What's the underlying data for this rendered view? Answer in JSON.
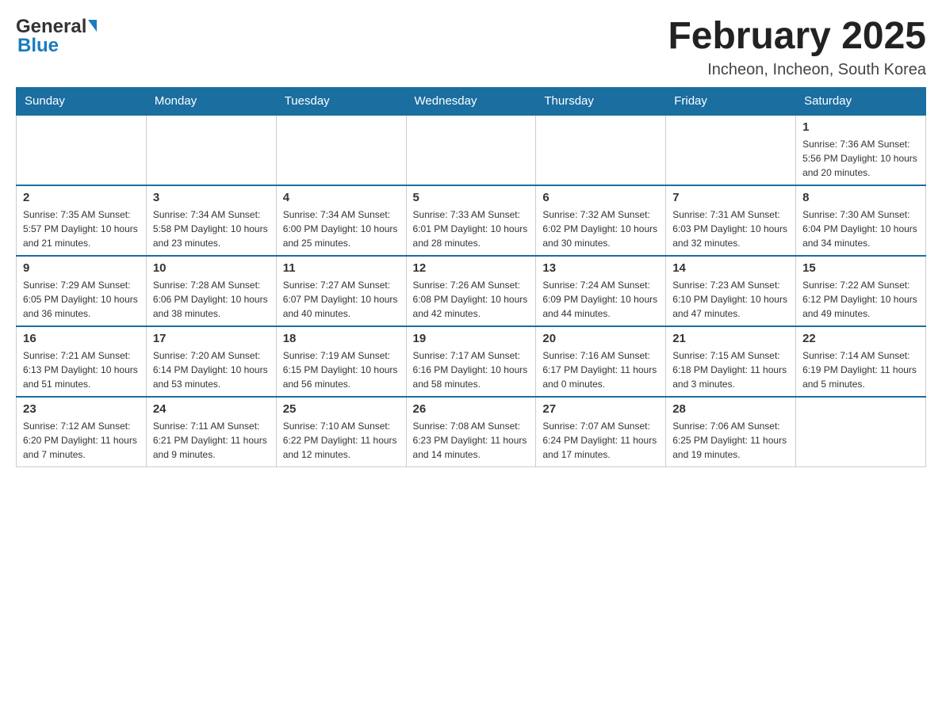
{
  "header": {
    "logo_general": "General",
    "logo_blue": "Blue",
    "title": "February 2025",
    "location": "Incheon, Incheon, South Korea"
  },
  "weekdays": [
    "Sunday",
    "Monday",
    "Tuesday",
    "Wednesday",
    "Thursday",
    "Friday",
    "Saturday"
  ],
  "weeks": [
    {
      "days": [
        {
          "number": "",
          "info": ""
        },
        {
          "number": "",
          "info": ""
        },
        {
          "number": "",
          "info": ""
        },
        {
          "number": "",
          "info": ""
        },
        {
          "number": "",
          "info": ""
        },
        {
          "number": "",
          "info": ""
        },
        {
          "number": "1",
          "info": "Sunrise: 7:36 AM\nSunset: 5:56 PM\nDaylight: 10 hours and 20 minutes."
        }
      ]
    },
    {
      "days": [
        {
          "number": "2",
          "info": "Sunrise: 7:35 AM\nSunset: 5:57 PM\nDaylight: 10 hours and 21 minutes."
        },
        {
          "number": "3",
          "info": "Sunrise: 7:34 AM\nSunset: 5:58 PM\nDaylight: 10 hours and 23 minutes."
        },
        {
          "number": "4",
          "info": "Sunrise: 7:34 AM\nSunset: 6:00 PM\nDaylight: 10 hours and 25 minutes."
        },
        {
          "number": "5",
          "info": "Sunrise: 7:33 AM\nSunset: 6:01 PM\nDaylight: 10 hours and 28 minutes."
        },
        {
          "number": "6",
          "info": "Sunrise: 7:32 AM\nSunset: 6:02 PM\nDaylight: 10 hours and 30 minutes."
        },
        {
          "number": "7",
          "info": "Sunrise: 7:31 AM\nSunset: 6:03 PM\nDaylight: 10 hours and 32 minutes."
        },
        {
          "number": "8",
          "info": "Sunrise: 7:30 AM\nSunset: 6:04 PM\nDaylight: 10 hours and 34 minutes."
        }
      ]
    },
    {
      "days": [
        {
          "number": "9",
          "info": "Sunrise: 7:29 AM\nSunset: 6:05 PM\nDaylight: 10 hours and 36 minutes."
        },
        {
          "number": "10",
          "info": "Sunrise: 7:28 AM\nSunset: 6:06 PM\nDaylight: 10 hours and 38 minutes."
        },
        {
          "number": "11",
          "info": "Sunrise: 7:27 AM\nSunset: 6:07 PM\nDaylight: 10 hours and 40 minutes."
        },
        {
          "number": "12",
          "info": "Sunrise: 7:26 AM\nSunset: 6:08 PM\nDaylight: 10 hours and 42 minutes."
        },
        {
          "number": "13",
          "info": "Sunrise: 7:24 AM\nSunset: 6:09 PM\nDaylight: 10 hours and 44 minutes."
        },
        {
          "number": "14",
          "info": "Sunrise: 7:23 AM\nSunset: 6:10 PM\nDaylight: 10 hours and 47 minutes."
        },
        {
          "number": "15",
          "info": "Sunrise: 7:22 AM\nSunset: 6:12 PM\nDaylight: 10 hours and 49 minutes."
        }
      ]
    },
    {
      "days": [
        {
          "number": "16",
          "info": "Sunrise: 7:21 AM\nSunset: 6:13 PM\nDaylight: 10 hours and 51 minutes."
        },
        {
          "number": "17",
          "info": "Sunrise: 7:20 AM\nSunset: 6:14 PM\nDaylight: 10 hours and 53 minutes."
        },
        {
          "number": "18",
          "info": "Sunrise: 7:19 AM\nSunset: 6:15 PM\nDaylight: 10 hours and 56 minutes."
        },
        {
          "number": "19",
          "info": "Sunrise: 7:17 AM\nSunset: 6:16 PM\nDaylight: 10 hours and 58 minutes."
        },
        {
          "number": "20",
          "info": "Sunrise: 7:16 AM\nSunset: 6:17 PM\nDaylight: 11 hours and 0 minutes."
        },
        {
          "number": "21",
          "info": "Sunrise: 7:15 AM\nSunset: 6:18 PM\nDaylight: 11 hours and 3 minutes."
        },
        {
          "number": "22",
          "info": "Sunrise: 7:14 AM\nSunset: 6:19 PM\nDaylight: 11 hours and 5 minutes."
        }
      ]
    },
    {
      "days": [
        {
          "number": "23",
          "info": "Sunrise: 7:12 AM\nSunset: 6:20 PM\nDaylight: 11 hours and 7 minutes."
        },
        {
          "number": "24",
          "info": "Sunrise: 7:11 AM\nSunset: 6:21 PM\nDaylight: 11 hours and 9 minutes."
        },
        {
          "number": "25",
          "info": "Sunrise: 7:10 AM\nSunset: 6:22 PM\nDaylight: 11 hours and 12 minutes."
        },
        {
          "number": "26",
          "info": "Sunrise: 7:08 AM\nSunset: 6:23 PM\nDaylight: 11 hours and 14 minutes."
        },
        {
          "number": "27",
          "info": "Sunrise: 7:07 AM\nSunset: 6:24 PM\nDaylight: 11 hours and 17 minutes."
        },
        {
          "number": "28",
          "info": "Sunrise: 7:06 AM\nSunset: 6:25 PM\nDaylight: 11 hours and 19 minutes."
        },
        {
          "number": "",
          "info": ""
        }
      ]
    }
  ]
}
